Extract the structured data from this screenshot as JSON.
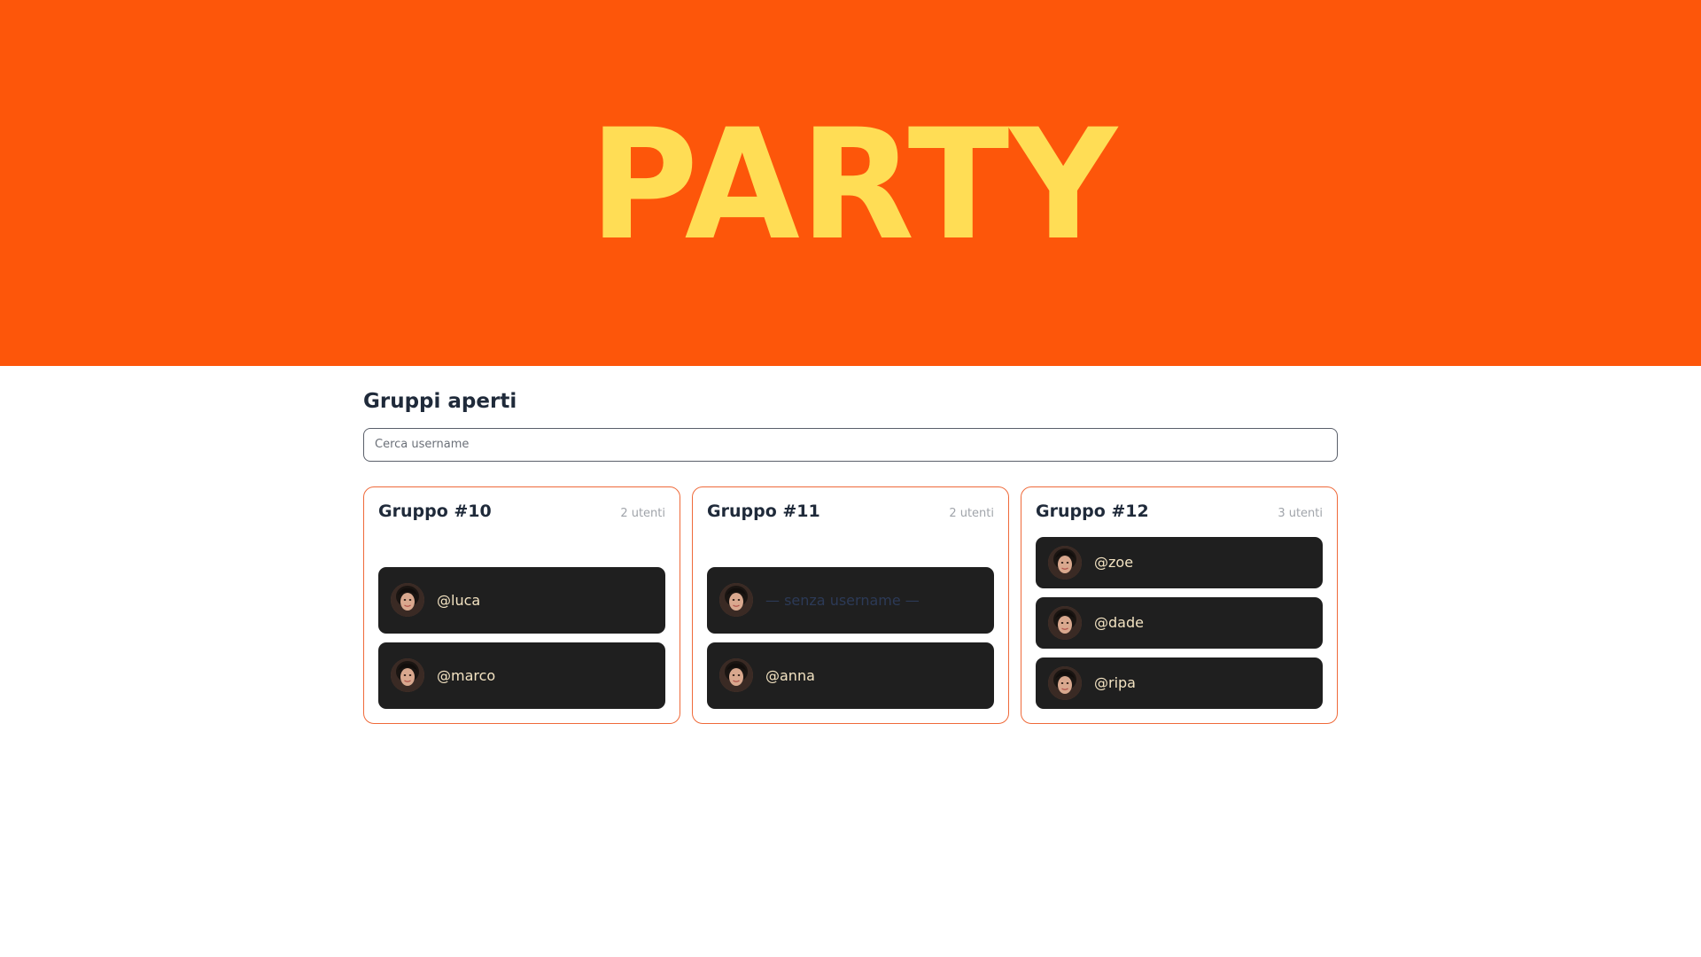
{
  "hero": {
    "logo_text": "PARTY",
    "background_color": "#fd560a",
    "logo_color": "#ffdd55"
  },
  "main": {
    "title": "Gruppi aperti",
    "search": {
      "placeholder": "Cerca username",
      "value": ""
    }
  },
  "groups": [
    {
      "title": "Gruppo #10",
      "count": "2 utenti",
      "members": [
        {
          "name": "@luca",
          "icon": "avatar"
        },
        {
          "name": "@marco",
          "icon": "avatar"
        }
      ]
    },
    {
      "title": "Gruppo #11",
      "count": "2 utenti",
      "members": [
        {
          "name": "— senza username —",
          "icon": "avatar"
        },
        {
          "name": "@anna",
          "icon": "avatar"
        }
      ]
    },
    {
      "title": "Gruppo #12",
      "count": "3 utenti",
      "members": [
        {
          "name": "@zoe",
          "icon": "avatar"
        },
        {
          "name": "@dade",
          "icon": "avatar"
        },
        {
          "name": "@ripa",
          "icon": "avatar"
        }
      ]
    }
  ],
  "colors": {
    "accent": "#fd560a",
    "card_border": "#ef6a3a",
    "member_bg": "#1f1f1f",
    "member_text": "#f3e3c2",
    "title_text": "#1f2a3a"
  }
}
